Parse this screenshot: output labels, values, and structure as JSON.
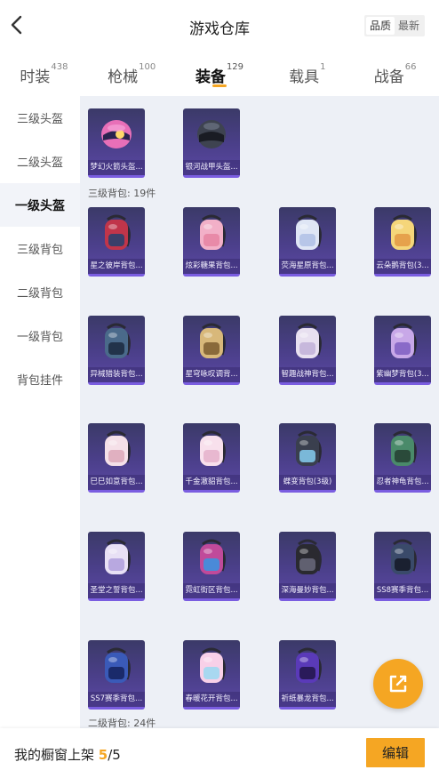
{
  "header": {
    "title": "游戏仓库",
    "sort_options": [
      "品质",
      "最新"
    ],
    "sort_active": 0
  },
  "tabs": [
    {
      "label": "时装",
      "count": "438"
    },
    {
      "label": "枪械",
      "count": "100"
    },
    {
      "label": "装备",
      "count": "129",
      "active": true
    },
    {
      "label": "载具",
      "count": "1"
    },
    {
      "label": "战备",
      "count": "66"
    }
  ],
  "sidebar": {
    "items": [
      "三级头盔",
      "二级头盔",
      "一级头盔",
      "三级背包",
      "二级背包",
      "一级背包",
      "背包挂件"
    ],
    "active": 2
  },
  "sections": {
    "third_bag": "三级背包: 19件",
    "second_bag": "二级背包: 24件"
  },
  "helmets": [
    {
      "name": "梦幻火箭头盔...",
      "icon": "pink-helmet-icon"
    },
    {
      "name": "银河战甲头盔...",
      "icon": "dark-helmet-icon"
    }
  ],
  "backpacks": [
    {
      "name": "星之彼岸背包...",
      "icon": "backpack-icon"
    },
    {
      "name": "炫彩糖果背包...",
      "icon": "backpack-icon"
    },
    {
      "name": "荧海星原背包...",
      "icon": "backpack-icon"
    },
    {
      "name": "云朵鹅背包(3...",
      "icon": "backpack-icon"
    },
    {
      "name": "异械猎装背包...",
      "icon": "backpack-icon"
    },
    {
      "name": "星穹咏叹调背...",
      "icon": "backpack-icon"
    },
    {
      "name": "智趣战神背包...",
      "icon": "backpack-icon"
    },
    {
      "name": "紫幽梦背包(3...",
      "icon": "backpack-icon"
    },
    {
      "name": "巳巳如意背包...",
      "icon": "backpack-icon"
    },
    {
      "name": "千金澈貂背包...",
      "icon": "backpack-icon"
    },
    {
      "name": "蝶变背包(3级)",
      "icon": "backpack-icon"
    },
    {
      "name": "忍者神龟背包...",
      "icon": "backpack-icon"
    },
    {
      "name": "圣堂之誓背包...",
      "icon": "backpack-icon"
    },
    {
      "name": "霓虹街区背包...",
      "icon": "backpack-icon"
    },
    {
      "name": "深海曼妙背包...",
      "icon": "backpack-icon"
    },
    {
      "name": "SS8赛季背包...",
      "icon": "backpack-icon"
    },
    {
      "name": "SS7赛季背包...",
      "icon": "backpack-icon"
    },
    {
      "name": "春暖花开背包...",
      "icon": "backpack-icon"
    },
    {
      "name": "祈纸暴龙背包...",
      "icon": "backpack-icon"
    }
  ],
  "bottom": {
    "label": "我的橱窗上架",
    "current": "5",
    "total": "/5",
    "edit_label": "编辑"
  },
  "colors": {
    "accent": "#f5a623",
    "card_bg": "#4b3f8a",
    "content_bg": "#edf0f6"
  }
}
